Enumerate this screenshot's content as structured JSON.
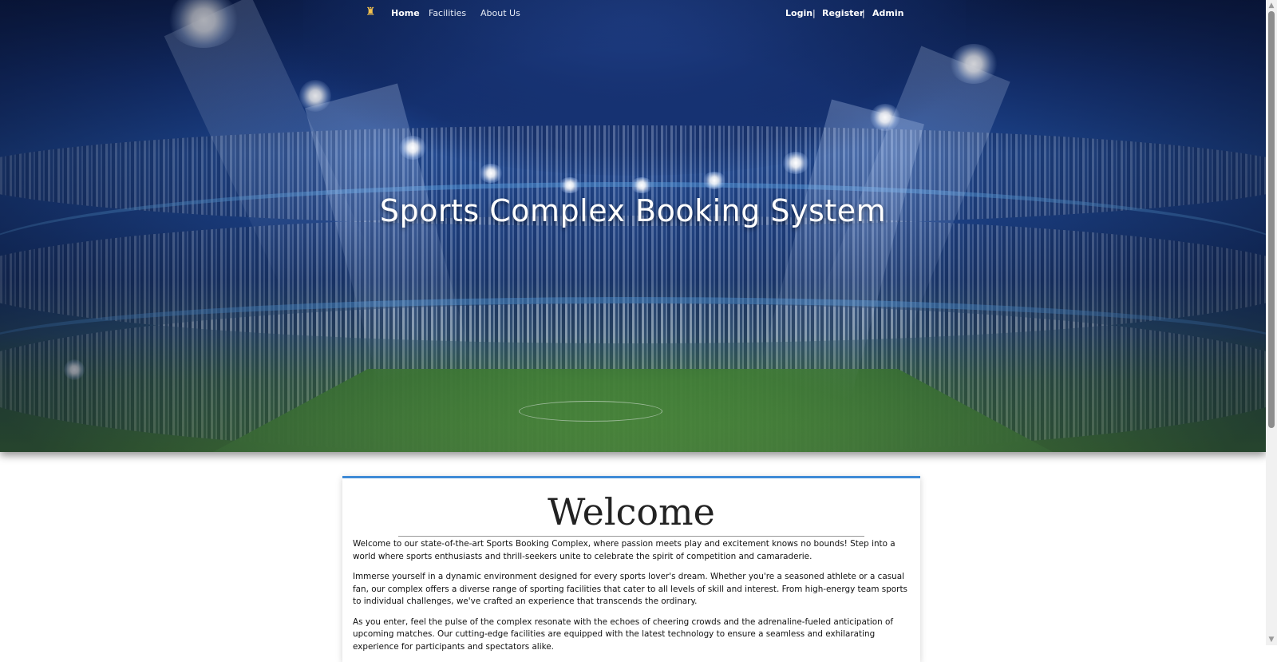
{
  "nav": {
    "home": "Home",
    "facilities": "Facilities",
    "about": "About Us",
    "login": "Login",
    "separator": "|",
    "register": "Register",
    "admin": "Admin"
  },
  "hero": {
    "title": "Sports Complex Booking System"
  },
  "welcome": {
    "heading": "Welcome",
    "paragraphs": [
      "Welcome to our state-of-the-art Sports Booking Complex, where passion meets play and excitement knows no bounds! Step into a world where sports enthusiasts and thrill-seekers unite to celebrate the spirit of competition and camaraderie.",
      "Immerse yourself in a dynamic environment designed for every sports lover's dream. Whether you're a seasoned athlete or a casual fan, our complex offers a diverse range of sporting facilities that cater to all levels of skill and interest. From high-energy team sports to individual challenges, we've crafted an experience that transcends the ordinary.",
      "As you enter, feel the pulse of the complex resonate with the echoes of cheering crowds and the adrenaline-fueled anticipation of upcoming matches. Our cutting-edge facilities are equipped with the latest technology to ensure a seamless and exhilarating experience for participants and spectators alike."
    ]
  },
  "icons": {
    "logo": "sports-logo-icon",
    "scroll_up": "▲",
    "scroll_down": "▼"
  },
  "colors": {
    "accent": "#3f8bd6",
    "hero_dark": "#0d1f4e"
  }
}
